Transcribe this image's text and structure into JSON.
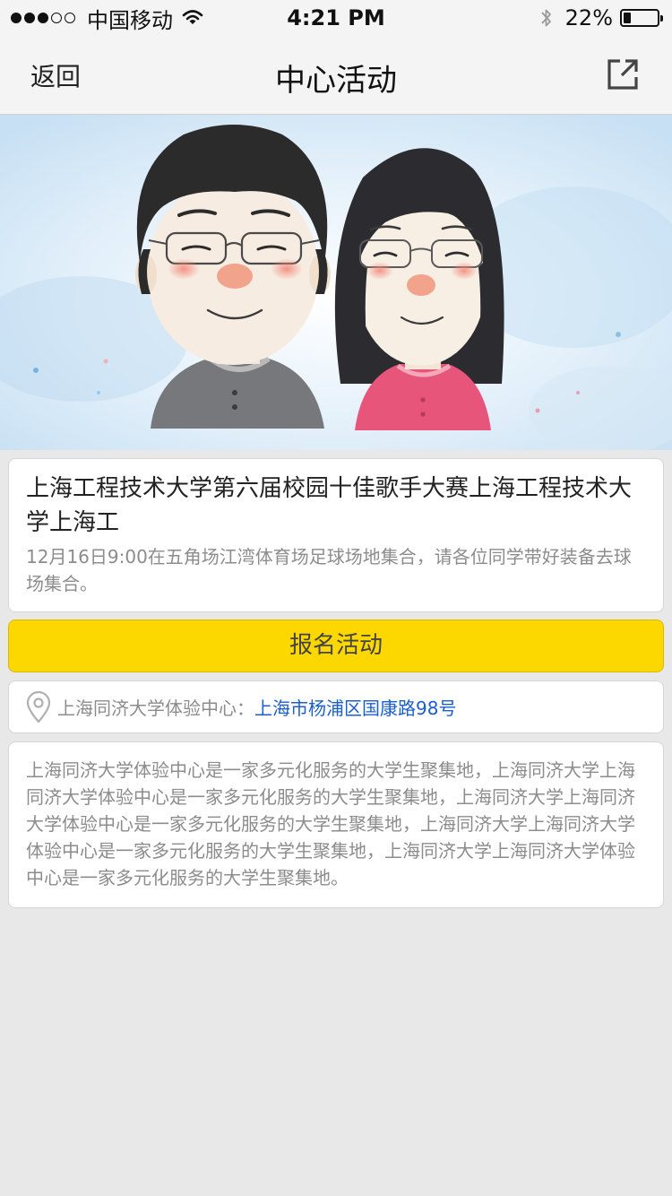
{
  "statusbar": {
    "carrier": "中国移动",
    "time": "4:21 PM",
    "battery_text": "22%",
    "battery_level": 0.22
  },
  "nav": {
    "back_label": "返回",
    "title": "中心活动"
  },
  "event": {
    "title": "上海工程技术大学第六届校园十佳歌手大赛上海工程技术大学上海工",
    "description": "12月16日9:00在五角场江湾体育场足球场地集合，请各位同学带好装备去球场集合。",
    "signup_label": "报名活动"
  },
  "location": {
    "label": "上海同济大学体验中心：",
    "address": "上海市杨浦区国康路98号"
  },
  "info": {
    "text": "上海同济大学体验中心是一家多元化服务的大学生聚集地，上海同济大学上海同济大学体验中心是一家多元化服务的大学生聚集地，上海同济大学上海同济大学体验中心是一家多元化服务的大学生聚集地，上海同济大学上海同济大学体验中心是一家多元化服务的大学生聚集地，上海同济大学上海同济大学体验中心是一家多元化服务的大学生聚集地。"
  },
  "colors": {
    "accent_yellow": "#fcd800",
    "link_blue": "#1a5fcc",
    "background": "#e8e8e8"
  },
  "icons": {
    "share": "share-icon",
    "location": "location-pin-icon",
    "wifi": "wifi-icon",
    "bluetooth": "bluetooth-icon"
  }
}
